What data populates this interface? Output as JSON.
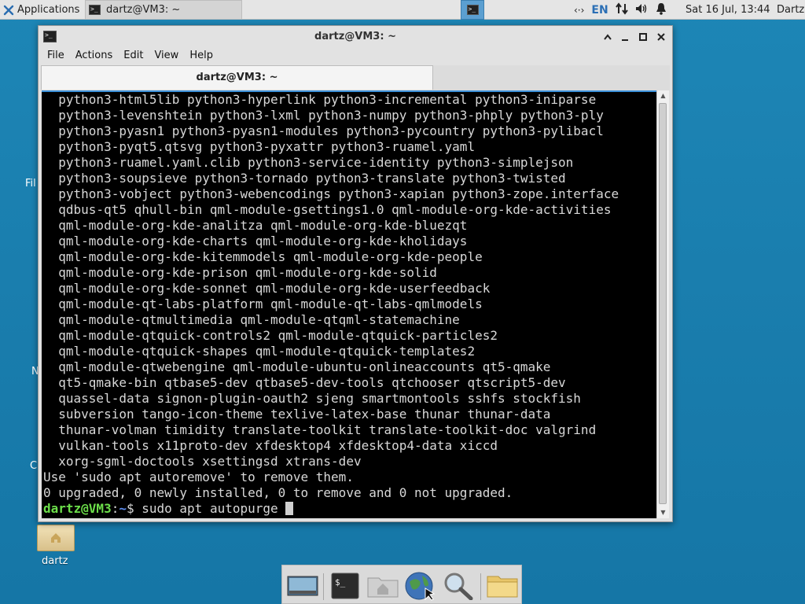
{
  "top_panel": {
    "apps_label": "Applications",
    "task_label": "dartz@VM3: ~",
    "lang": "EN",
    "clock": "Sat 16 Jul, 13:44",
    "user": "Dartz"
  },
  "desktop": {
    "home_label": "dartz",
    "clipped_labels": [
      "Fil",
      "N",
      "C"
    ]
  },
  "window": {
    "title": "dartz@VM3: ~",
    "menu": [
      "File",
      "Actions",
      "Edit",
      "View",
      "Help"
    ],
    "tab_label": "dartz@VM3: ~",
    "terminal": {
      "lines": [
        "  python3-html5lib python3-hyperlink python3-incremental python3-iniparse",
        "  python3-levenshtein python3-lxml python3-numpy python3-phply python3-ply",
        "  python3-pyasn1 python3-pyasn1-modules python3-pycountry python3-pylibacl",
        "  python3-pyqt5.qtsvg python3-pyxattr python3-ruamel.yaml",
        "  python3-ruamel.yaml.clib python3-service-identity python3-simplejson",
        "  python3-soupsieve python3-tornado python3-translate python3-twisted",
        "  python3-vobject python3-webencodings python3-xapian python3-zope.interface",
        "  qdbus-qt5 qhull-bin qml-module-gsettings1.0 qml-module-org-kde-activities",
        "  qml-module-org-kde-analitza qml-module-org-kde-bluezqt",
        "  qml-module-org-kde-charts qml-module-org-kde-kholidays",
        "  qml-module-org-kde-kitemmodels qml-module-org-kde-people",
        "  qml-module-org-kde-prison qml-module-org-kde-solid",
        "  qml-module-org-kde-sonnet qml-module-org-kde-userfeedback",
        "  qml-module-qt-labs-platform qml-module-qt-labs-qmlmodels",
        "  qml-module-qtmultimedia qml-module-qtqml-statemachine",
        "  qml-module-qtquick-controls2 qml-module-qtquick-particles2",
        "  qml-module-qtquick-shapes qml-module-qtquick-templates2",
        "  qml-module-qtwebengine qml-module-ubuntu-onlineaccounts qt5-qmake",
        "  qt5-qmake-bin qtbase5-dev qtbase5-dev-tools qtchooser qtscript5-dev",
        "  quassel-data signon-plugin-oauth2 sjeng smartmontools sshfs stockfish",
        "  subversion tango-icon-theme texlive-latex-base thunar thunar-data",
        "  thunar-volman timidity translate-toolkit translate-toolkit-doc valgrind",
        "  vulkan-tools x11proto-dev xfdesktop4 xfdesktop4-data xiccd",
        "  xorg-sgml-doctools xsettingsd xtrans-dev",
        "Use 'sudo apt autoremove' to remove them.",
        "0 upgraded, 0 newly installed, 0 to remove and 0 not upgraded."
      ],
      "prompt_user": "dartz@VM3",
      "prompt_sep": ":",
      "prompt_path": "~",
      "prompt_symbol": "$ ",
      "command": "sudo apt autopurge "
    }
  },
  "dock": {
    "items": [
      "show-desktop",
      "terminal",
      "home-folder",
      "web-browser",
      "app-finder",
      "file-manager"
    ]
  },
  "colors": {
    "desktop_bg": "#1a7eae",
    "prompt_user": "#6cdf4a",
    "prompt_path": "#5d8df0",
    "panel_bg": "#e5e5e5"
  }
}
